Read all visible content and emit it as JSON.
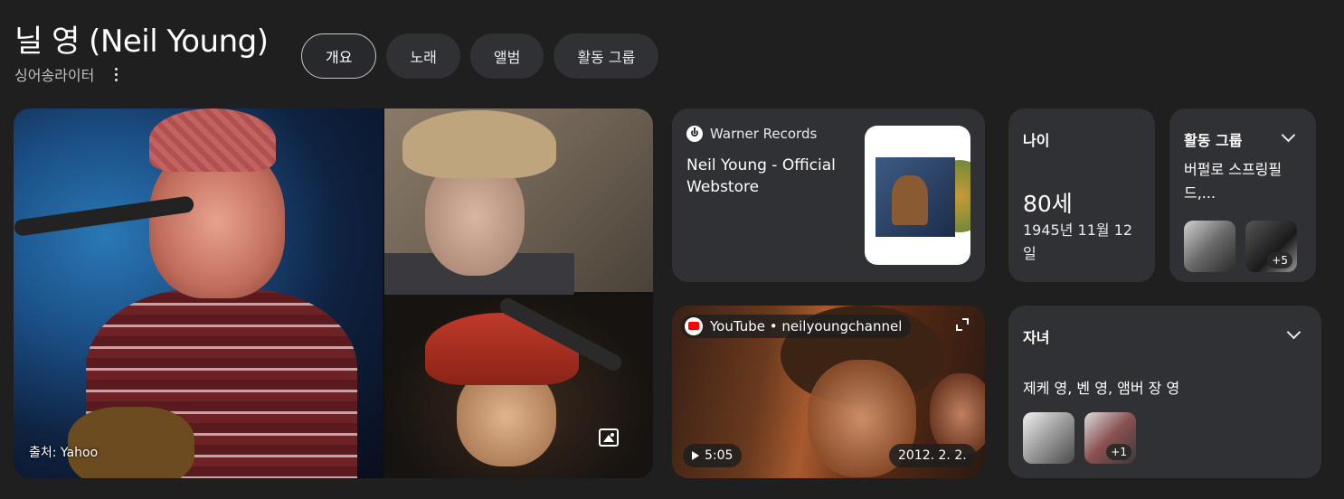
{
  "header": {
    "title": "닐 영 (Neil Young)",
    "subtitle": "싱어송라이터"
  },
  "tabs": [
    {
      "label": "개요",
      "active": true
    },
    {
      "label": "노래",
      "active": false
    },
    {
      "label": "앨범",
      "active": false
    },
    {
      "label": "활동 그룹",
      "active": false
    }
  ],
  "images": {
    "source_label": "출처: Yahoo"
  },
  "store": {
    "source": "Warner Records",
    "name": "Neil Young - Official Webstore"
  },
  "video": {
    "source": "YouTube • neilyoungchannel",
    "duration": "5:05",
    "date": "2012. 2. 2."
  },
  "age": {
    "label": "나이",
    "value": "80세",
    "birth_date": "1945년 11월 12일"
  },
  "group": {
    "label": "활동 그룹",
    "value": "버펄로 스프링필드,...",
    "more_count": "+5"
  },
  "children": {
    "label": "자녀",
    "value": "제케 영, 벤 영, 앰버 장 영",
    "more_count": "+1"
  },
  "colors": {
    "background": "#1f1f1f",
    "card": "#303134",
    "youtube_red": "#ff0000"
  }
}
